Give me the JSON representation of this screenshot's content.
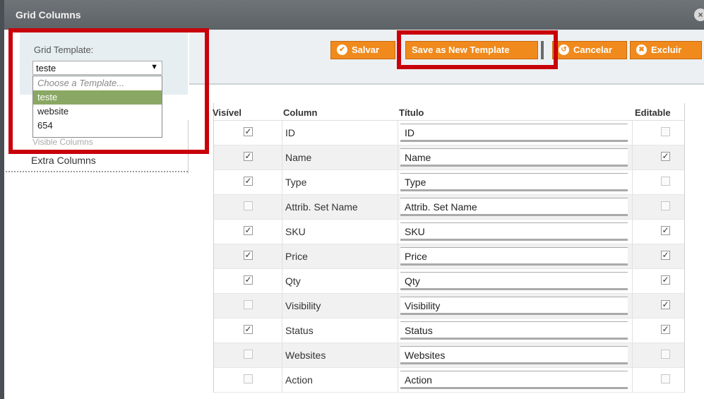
{
  "window": {
    "title": "Grid Columns",
    "close_glyph": "×"
  },
  "sidebar": {
    "template_label": "Grid Template:",
    "selected_template": "teste",
    "options": [
      "Choose a Template...",
      "teste",
      "website",
      "654"
    ],
    "hidden_item": "Visible Columns",
    "extra_columns": "Extra Columns"
  },
  "toolbar": {
    "save_label": "Salvar",
    "save_new_label": "Save as New Template",
    "cancel_label": "Cancelar",
    "delete_label": "Excluir"
  },
  "table": {
    "headers": {
      "visible": "Visível",
      "column": "Column",
      "title": "Título",
      "editable": "Editable"
    },
    "rows": [
      {
        "visible": true,
        "column": "ID",
        "title": "ID",
        "editable": false
      },
      {
        "visible": true,
        "column": "Name",
        "title": "Name",
        "editable": true
      },
      {
        "visible": true,
        "column": "Type",
        "title": "Type",
        "editable": false
      },
      {
        "visible": false,
        "column": "Attrib. Set Name",
        "title": "Attrib. Set Name",
        "editable": false
      },
      {
        "visible": true,
        "column": "SKU",
        "title": "SKU",
        "editable": true
      },
      {
        "visible": true,
        "column": "Price",
        "title": "Price",
        "editable": true
      },
      {
        "visible": true,
        "column": "Qty",
        "title": "Qty",
        "editable": true
      },
      {
        "visible": false,
        "column": "Visibility",
        "title": "Visibility",
        "editable": true
      },
      {
        "visible": true,
        "column": "Status",
        "title": "Status",
        "editable": true
      },
      {
        "visible": false,
        "column": "Websites",
        "title": "Websites",
        "editable": false
      },
      {
        "visible": false,
        "column": "Action",
        "title": "Action",
        "editable": false
      }
    ]
  },
  "colors": {
    "accent": "#f08a1c",
    "highlight": "#c8000a",
    "selected_option": "#8aa863"
  },
  "icons": {
    "save": "check-circle-icon",
    "cancel": "cancel-circle-icon",
    "delete": "delete-circle-icon",
    "close": "close-icon"
  }
}
